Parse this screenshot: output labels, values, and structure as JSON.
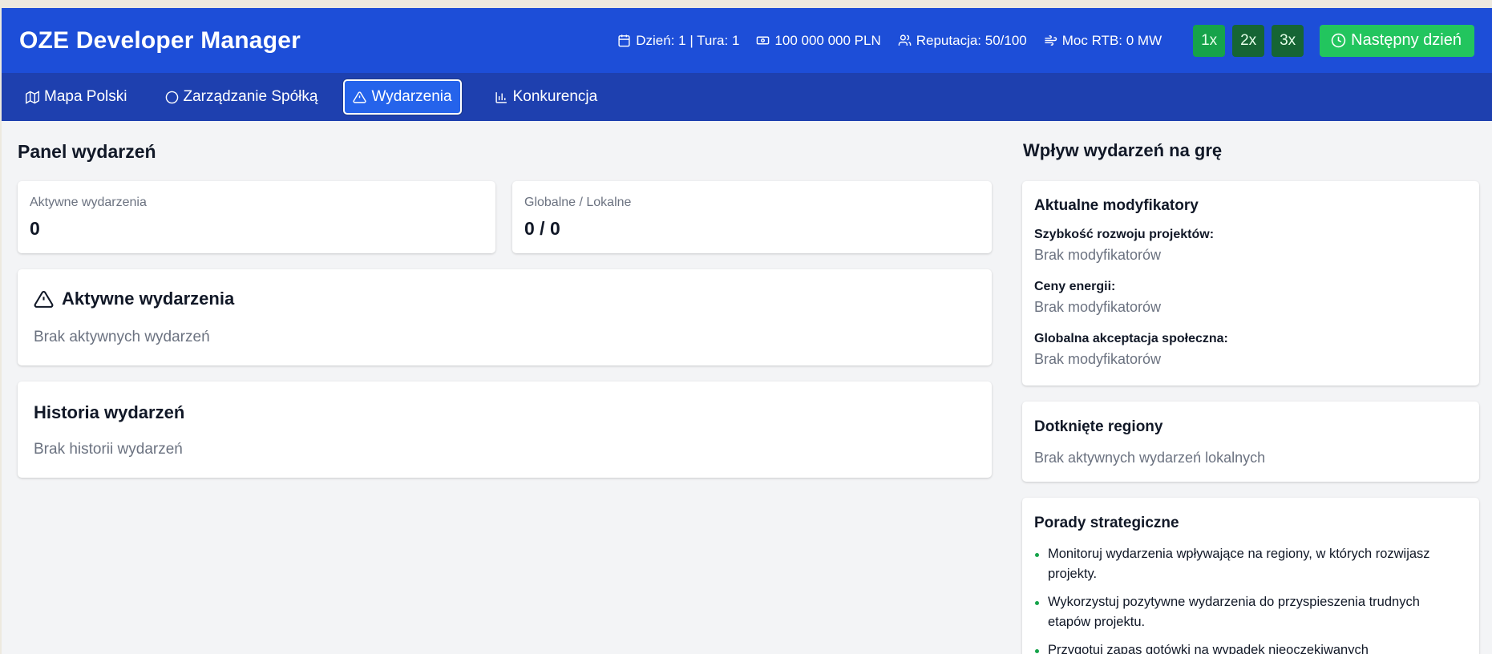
{
  "app": {
    "title": "OZE Developer Manager"
  },
  "header": {
    "day_turn": "Dzień: 1 | Tura: 1",
    "cash": "100 000 000 PLN",
    "reputation": "Reputacja: 50/100",
    "power": "Moc RTB: 0 MW",
    "speeds": [
      "1x",
      "2x",
      "3x"
    ],
    "active_speed": "1x",
    "next_day": "Następny dzień",
    "icons": [
      "calendar-icon",
      "money-icon",
      "users-icon",
      "wind-icon",
      "clock-icon"
    ],
    "colors": {
      "header_bg": "#1d4ed8",
      "nav_bg": "#1e40af",
      "accent_green": "#22c55e"
    }
  },
  "nav": {
    "tabs": [
      {
        "label": "Mapa Polski",
        "icon": "map-icon"
      },
      {
        "label": "Zarządzanie Spółką",
        "icon": "circle-icon"
      },
      {
        "label": "Wydarzenia",
        "icon": "alert-triangle-icon",
        "active": true
      },
      {
        "label": "Konkurencja",
        "icon": "bar-chart-icon"
      }
    ]
  },
  "events_panel": {
    "title": "Panel wydarzeń",
    "stats": [
      {
        "label": "Aktywne wydarzenia",
        "value": "0"
      },
      {
        "label": "Globalne / Lokalne",
        "value": "0 / 0"
      }
    ],
    "active": {
      "title": "Aktywne wydarzenia",
      "empty": "Brak aktywnych wydarzeń"
    },
    "history": {
      "title": "Historia wydarzeń",
      "empty": "Brak historii wydarzeń"
    }
  },
  "impact": {
    "title": "Wpływ wydarzeń na grę",
    "modifiers": {
      "title": "Aktualne modyfikatory",
      "items": [
        {
          "label": "Szybkość rozwoju projektów:",
          "value": "Brak modyfikatorów"
        },
        {
          "label": "Ceny energii:",
          "value": "Brak modyfikatorów"
        },
        {
          "label": "Globalna akceptacja społeczna:",
          "value": "Brak modyfikatorów"
        }
      ]
    },
    "regions": {
      "title": "Dotknięte regiony",
      "empty": "Brak aktywnych wydarzeń lokalnych"
    },
    "tips": {
      "title": "Porady strategiczne",
      "items": [
        "Monitoruj wydarzenia wpływające na regiony, w których rozwijasz projekty.",
        "Wykorzystuj pozytywne wydarzenia do przyspieszenia trudnych etapów projektu.",
        "Przygotuj zapas gotówki na wypadek nieoczekiwanych"
      ]
    }
  }
}
